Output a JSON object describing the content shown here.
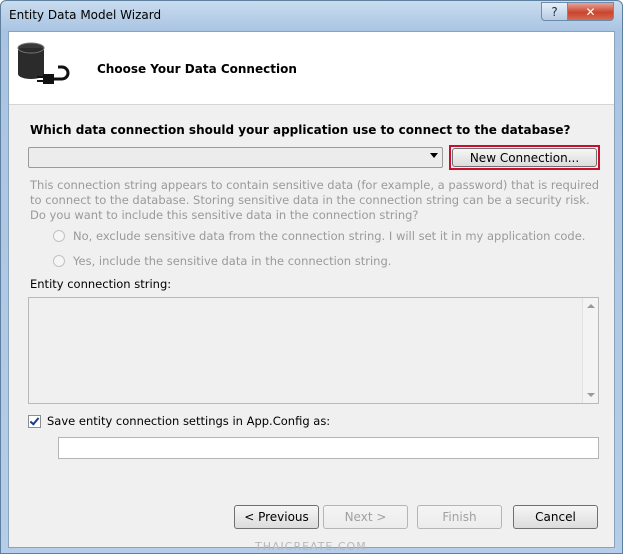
{
  "window": {
    "title": "Entity Data Model Wizard",
    "help_label": "?",
    "close_label": "✕"
  },
  "header": {
    "title": "Choose Your Data Connection",
    "icon": "database-plug-icon"
  },
  "connection": {
    "question": "Which data connection should your application use to connect to the database?",
    "selected_value": "",
    "new_connection_label": "New Connection..."
  },
  "sensitive": {
    "info": "This connection string appears to contain sensitive data (for example, a password) that is required to connect to the database. Storing sensitive data in the connection string can be a security risk. Do you want to include this sensitive data in the connection string?",
    "option_no": "No, exclude sensitive data from the connection string. I will set it in my application code.",
    "option_yes": "Yes, include the sensitive data in the connection string."
  },
  "entity_connection": {
    "label": "Entity connection string:",
    "value": ""
  },
  "config": {
    "checkbox_label": "Save entity connection settings in App.Config as:",
    "checked": true,
    "value": ""
  },
  "buttons": {
    "previous": "< Previous",
    "next": "Next >",
    "finish": "Finish",
    "cancel": "Cancel"
  },
  "watermark": "THAICREATE.COM",
  "colors": {
    "highlight_border": "#c8102e",
    "disabled_text": "#9a9a9a"
  }
}
